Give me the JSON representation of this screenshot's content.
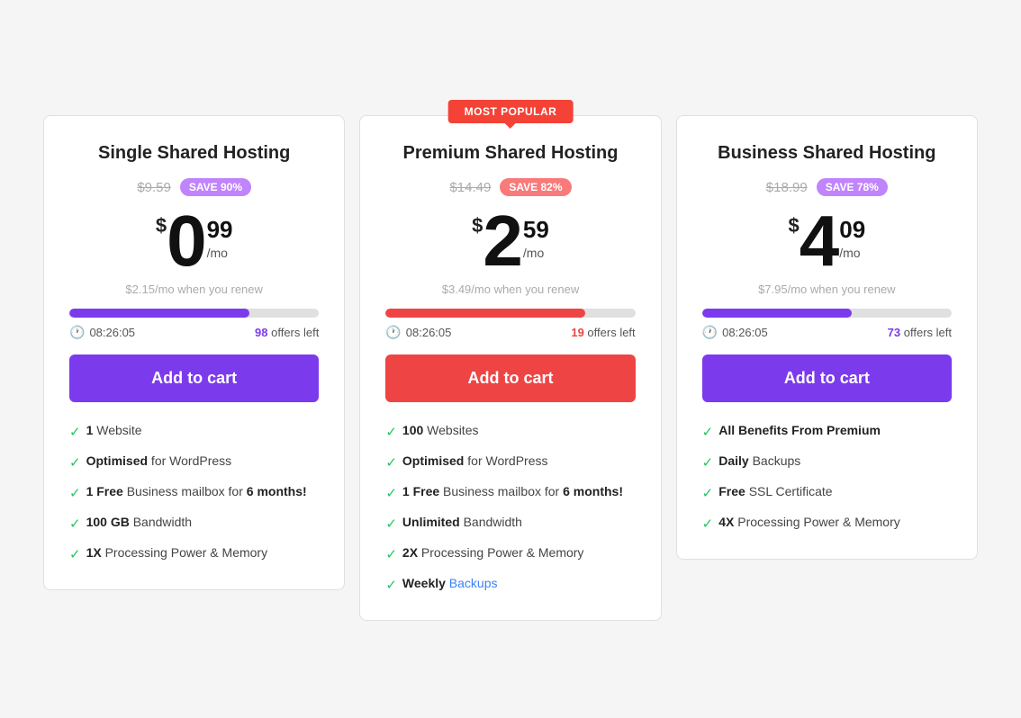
{
  "plans": [
    {
      "id": "single",
      "title": "Single Shared Hosting",
      "popular": false,
      "originalPrice": "$9.59",
      "saveBadge": "SAVE 90%",
      "saveBadgeColor": "purple",
      "priceMain": "0",
      "priceDollar": "$",
      "priceCents": "99",
      "priceMo": "/mo",
      "renewText": "$2.15/mo when you renew",
      "progressWidth": "72",
      "progressColor": "purple",
      "timer": "08:26:05",
      "timerColor": "purple",
      "offersLeft": "98",
      "offersText": "offers left",
      "buttonLabel": "Add to cart",
      "buttonColor": "purple",
      "features": [
        {
          "bold": "1",
          "rest": " Website"
        },
        {
          "bold": "Optimised",
          "rest": " for WordPress"
        },
        {
          "bold": "1 Free",
          "rest": " Business mailbox for ",
          "bold2": "6 months!"
        },
        {
          "bold": "100 GB",
          "rest": " Bandwidth"
        },
        {
          "bold": "1X",
          "rest": " Processing Power & Memory"
        }
      ]
    },
    {
      "id": "premium",
      "title": "Premium Shared Hosting",
      "popular": true,
      "popularLabel": "MOST POPULAR",
      "originalPrice": "$14.49",
      "saveBadge": "SAVE 82%",
      "saveBadgeColor": "red",
      "priceMain": "2",
      "priceDollar": "$",
      "priceCents": "59",
      "priceMo": "/mo",
      "renewText": "$3.49/mo when you renew",
      "progressWidth": "80",
      "progressColor": "red",
      "timer": "08:26:05",
      "timerColor": "red",
      "offersLeft": "19",
      "offersText": "offers left",
      "buttonLabel": "Add to cart",
      "buttonColor": "red",
      "features": [
        {
          "bold": "100",
          "rest": " Websites"
        },
        {
          "bold": "Optimised",
          "rest": " for WordPress"
        },
        {
          "bold": "1 Free",
          "rest": " Business mailbox for ",
          "bold2": "6 months!"
        },
        {
          "bold": "Unlimited",
          "rest": " Bandwidth"
        },
        {
          "bold": "2X",
          "rest": " Processing Power & Memory"
        },
        {
          "bold": "Weekly",
          "rest": " Backups",
          "restColor": "blue"
        }
      ]
    },
    {
      "id": "business",
      "title": "Business Shared Hosting",
      "popular": false,
      "originalPrice": "$18.99",
      "saveBadge": "SAVE 78%",
      "saveBadgeColor": "purple",
      "priceMain": "4",
      "priceDollar": "$",
      "priceCents": "09",
      "priceMo": "/mo",
      "renewText": "$7.95/mo when you renew",
      "progressWidth": "60",
      "progressColor": "purple",
      "timer": "08:26:05",
      "timerColor": "purple",
      "offersLeft": "73",
      "offersText": "offers left",
      "buttonLabel": "Add to cart",
      "buttonColor": "purple",
      "features": [
        {
          "bold": "All Benefits From Premium",
          "rest": ""
        },
        {
          "bold": "Daily",
          "rest": " Backups"
        },
        {
          "bold": "Free",
          "rest": " SSL Certificate"
        },
        {
          "bold": "4X",
          "rest": " Processing Power & Memory"
        }
      ]
    }
  ]
}
